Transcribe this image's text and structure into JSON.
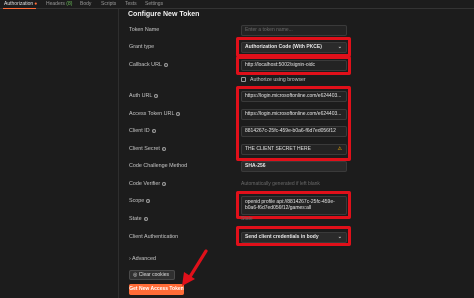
{
  "tabs": [
    {
      "label": "Authorization"
    },
    {
      "label": "Headers",
      "count": "(8)"
    },
    {
      "label": "Body"
    },
    {
      "label": "Scripts"
    },
    {
      "label": "Tests"
    },
    {
      "label": "Settings"
    }
  ],
  "section_title": "Configure New Token",
  "fields": {
    "token_name": {
      "label": "Token Name",
      "placeholder": "Enter a token name..."
    },
    "grant_type": {
      "label": "Grant type",
      "value": "Authorization Code (With PKCE)"
    },
    "callback_url": {
      "label": "Callback URL",
      "value": "http://localhost:5002/signin-oidc"
    },
    "authorize_browser": {
      "label": "Authorize using browser"
    },
    "auth_url": {
      "label": "Auth URL",
      "value": "https://login.microsoftonline.com/e624403..."
    },
    "access_token_url": {
      "label": "Access Token URL",
      "value": "https://login.microsoftonline.com/e624403..."
    },
    "client_id": {
      "label": "Client ID",
      "value": "8814267c-25fc-459e-b0a6-f6d7ed056f12"
    },
    "client_secret": {
      "label": "Client Secret",
      "value": "THE CLIENT SECRET HERE"
    },
    "code_challenge": {
      "label": "Code Challenge Method",
      "value": "SHA-256"
    },
    "code_verifier": {
      "label": "Code Verifier",
      "placeholder": "Automatically generated if left blank"
    },
    "scope": {
      "label": "Scope",
      "value": "openid profile api://8814267c-25fc-459e-b0a6-f6d7ed056f12/games:all"
    },
    "state": {
      "label": "State",
      "placeholder": "State"
    },
    "client_auth": {
      "label": "Client Authentication",
      "value": "Send client credentials in body"
    }
  },
  "advanced_label": "Advanced",
  "clear_cookies_label": "Clear cookies",
  "get_token_label": "Get New Access Token",
  "colors": {
    "accent": "#ff6c37",
    "highlight": "#e0101a",
    "background": "#1c1c1c"
  }
}
